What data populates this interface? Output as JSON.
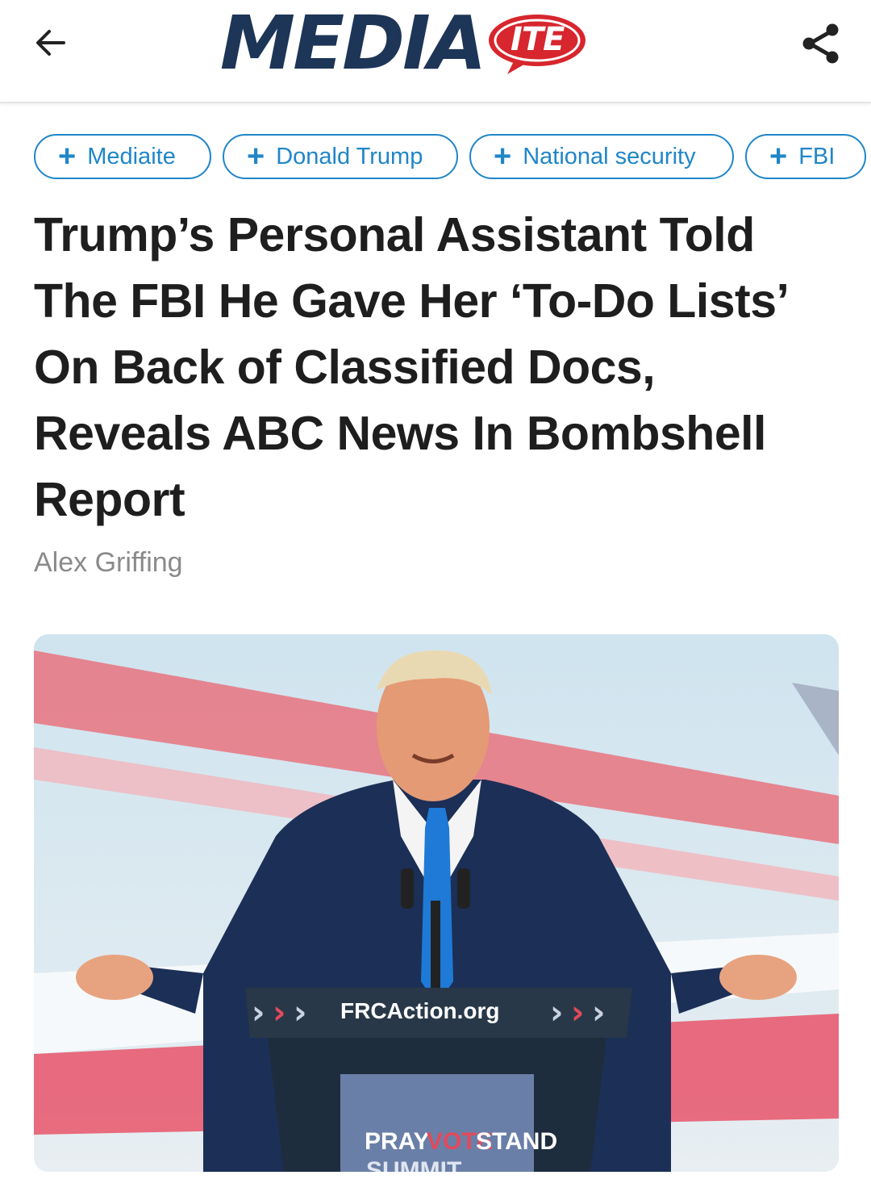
{
  "header": {
    "logo_main": "MEDIA",
    "logo_badge": "ITE",
    "back_icon": "arrow-left-icon",
    "share_icon": "share-icon",
    "brand_color": "#1d3557",
    "badge_color": "#d7262e"
  },
  "tags": [
    {
      "label": "Mediaite"
    },
    {
      "label": "Donald Trump"
    },
    {
      "label": "National security"
    },
    {
      "label": "FBI"
    }
  ],
  "tag_color": "#1f86c8",
  "article": {
    "headline": "Trump’s Personal Assistant Told The FBI He Gave Her ‘To-Do Lists’ On Back of Classified Docs, Reveals ABC News In Bombshell Report",
    "author": "Alex Griffing"
  },
  "photo": {
    "podium_banner": "FRCAction.org",
    "podium_sign_1": "PRAY",
    "podium_sign_2": "VOTE",
    "podium_sign_3": "STAND",
    "podium_sign_4": "SUMMIT"
  }
}
